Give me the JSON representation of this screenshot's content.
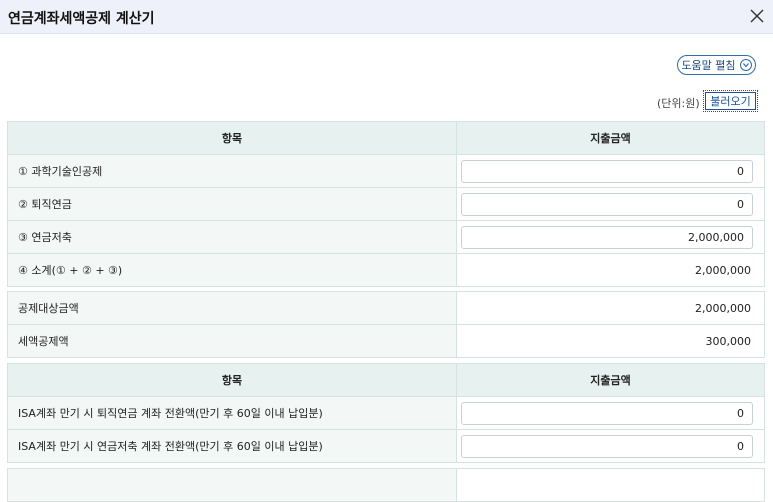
{
  "header": {
    "title": "연금계좌세액공제 계산기"
  },
  "toolbar": {
    "help_label": "도움말 펼침",
    "unit_label": "(단위:원)",
    "load_label": "불러오기"
  },
  "table1": {
    "col_item": "항목",
    "col_amount": "지출금액",
    "rows": [
      {
        "label": "① 과학기술인공제",
        "value": "0"
      },
      {
        "label": "② 퇴직연금",
        "value": "0"
      },
      {
        "label": "③ 연금저축",
        "value": "2,000,000"
      },
      {
        "label": "④ 소계(① + ② + ③)",
        "value": "2,000,000"
      }
    ]
  },
  "table2": {
    "rows": [
      {
        "label": "공제대상금액",
        "value": "2,000,000"
      },
      {
        "label": "세액공제액",
        "value": "300,000"
      }
    ]
  },
  "table3": {
    "col_item": "항목",
    "col_amount": "지출금액",
    "rows": [
      {
        "label": "ISA계좌 만기 시 퇴직연금 계좌 전환액(만기 후 60일 이내 납입분)",
        "value": "0"
      },
      {
        "label": "ISA계좌 만기 시 연금저축 계좌 전환액(만기 후 60일 이내 납입분)",
        "value": "0"
      }
    ]
  },
  "colors": {
    "header_bg": "#eef1fa",
    "table_header_bg": "#e7f2f0",
    "accent": "#1d4f9a"
  },
  "icons": {
    "close": "close-icon",
    "chevron": "chevron-down-icon"
  }
}
